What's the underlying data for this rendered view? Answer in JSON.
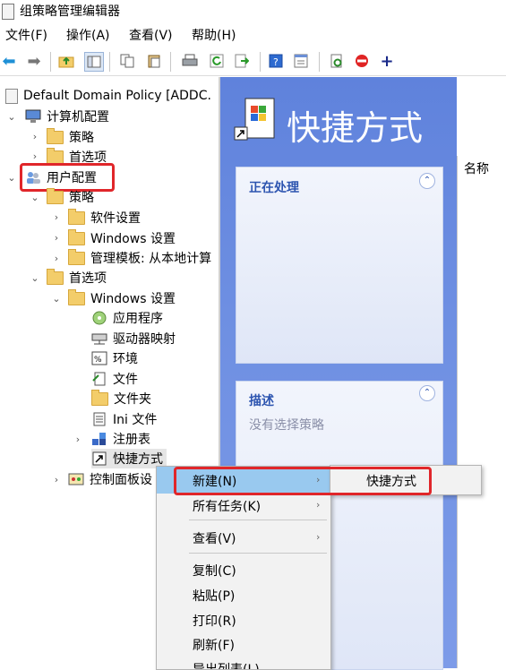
{
  "window": {
    "title": "组策略管理编辑器"
  },
  "menu": [
    "文件(F)",
    "操作(A)",
    "查看(V)",
    "帮助(H)"
  ],
  "tree": {
    "root": "Default Domain Policy [ADDC.",
    "computer_config": "计算机配置",
    "cc_policy": "策略",
    "cc_prefs": "首选项",
    "user_config": "用户配置",
    "uc_policy": "策略",
    "software_settings": "软件设置",
    "windows_settings_1": "Windows 设置",
    "admin_templates": "管理模板: 从本地计算",
    "uc_prefs": "首选项",
    "windows_settings_2": "Windows 设置",
    "applications": "应用程序",
    "drive_maps": "驱动器映射",
    "environment": "环境",
    "files": "文件",
    "folders": "文件夹",
    "ini_files": "Ini 文件",
    "registry": "注册表",
    "shortcuts": "快捷方式",
    "control_panel": "控制面板设"
  },
  "right": {
    "title": "快捷方式",
    "processing_header": "正在处理",
    "description_header": "描述",
    "description_text": "没有选择策略",
    "column_name": "名称"
  },
  "context_menu": {
    "new": "新建(N)",
    "all_tasks": "所有任务(K)",
    "view": "查看(V)",
    "copy": "复制(C)",
    "paste": "粘贴(P)",
    "print": "打印(R)",
    "refresh": "刷新(F)",
    "export_list": "导出列表(L)..."
  },
  "submenu": {
    "shortcut": "快捷方式"
  },
  "colors": {
    "highlight": "#e0262a",
    "pane_blue": "#6e8fe2",
    "menu_hover": "#99c9ef"
  }
}
